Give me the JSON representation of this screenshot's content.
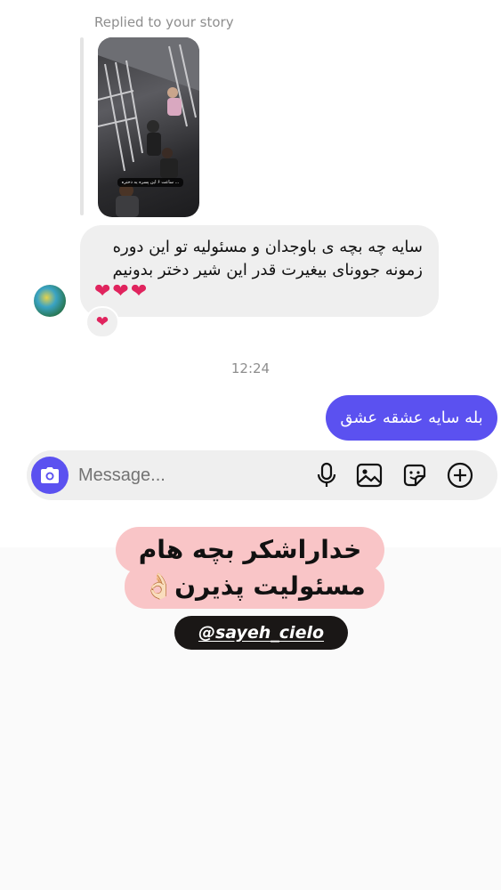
{
  "thread": {
    "reply_label": "Replied to your story",
    "story_caption": "ساعت ۶ این پسره یه دختره ...",
    "incoming_message": "سایه چه بچه ی باوجدان و مسئولیه تو این دوره زمونه جوونای بیغیرت قدر این شیر دختر بدونیم",
    "incoming_hearts": "❤❤❤",
    "reaction": "❤",
    "timestamp": "12:24",
    "outgoing_message": "بله سایه عشقه عشق"
  },
  "composer": {
    "placeholder": "Message...",
    "icons": [
      "camera-icon",
      "microphone-icon",
      "gallery-icon",
      "sticker-icon",
      "plus-icon"
    ]
  },
  "overlay": {
    "caption_line_1": "خداراشکر بچه هام",
    "caption_line_2": "مسئولیت پذیرن👌🏻",
    "handle": "@sayeh_cielo"
  },
  "colors": {
    "accent": "#5b51f0",
    "incoming_bubble": "#efefef",
    "caption_bg": "#f9c5c7",
    "handle_bg": "#1a1716",
    "heart": "#e0245e"
  }
}
